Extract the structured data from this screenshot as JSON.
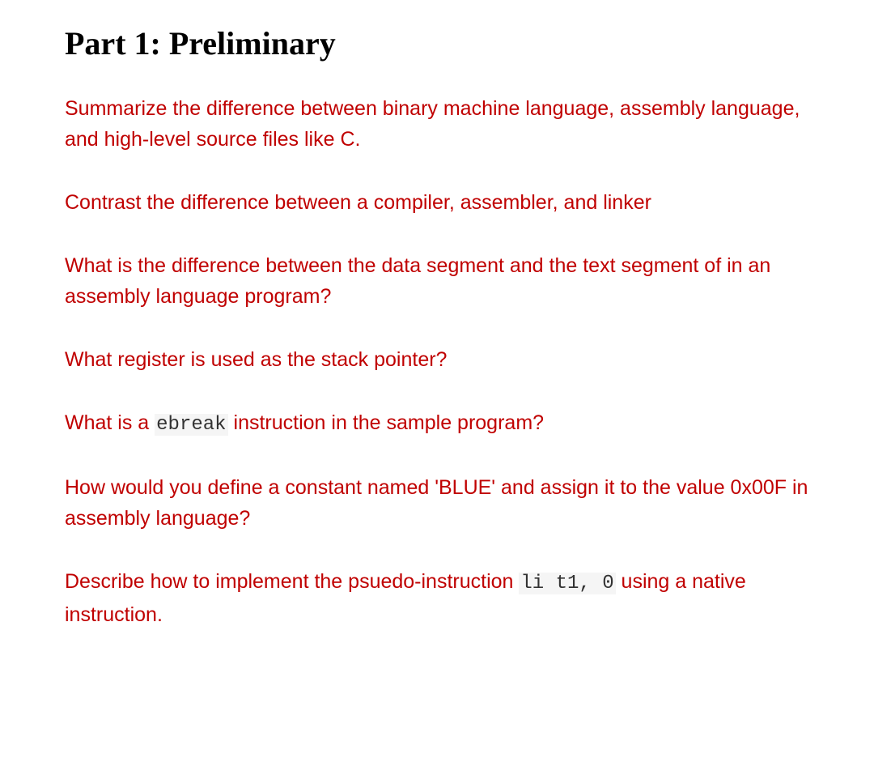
{
  "heading": "Part 1: Preliminary",
  "questions": {
    "q1": "Summarize the difference between binary machine language, assembly language, and high-level source files like C.",
    "q2": "Contrast the difference between a compiler, assembler, and linker",
    "q3": "What is the difference between the data segment and the text segment of in an assembly language program?",
    "q4": "What register is used as the stack pointer?",
    "q5_pre": "What is a ",
    "q5_code": "ebreak",
    "q5_post": " instruction in the sample program?",
    "q6": "How would you define a constant named 'BLUE' and assign it to the value 0x00F in assembly language?",
    "q7_pre": "Describe how to implement the psuedo-instruction ",
    "q7_code": "li t1, 0",
    "q7_post": " using a native instruction."
  }
}
